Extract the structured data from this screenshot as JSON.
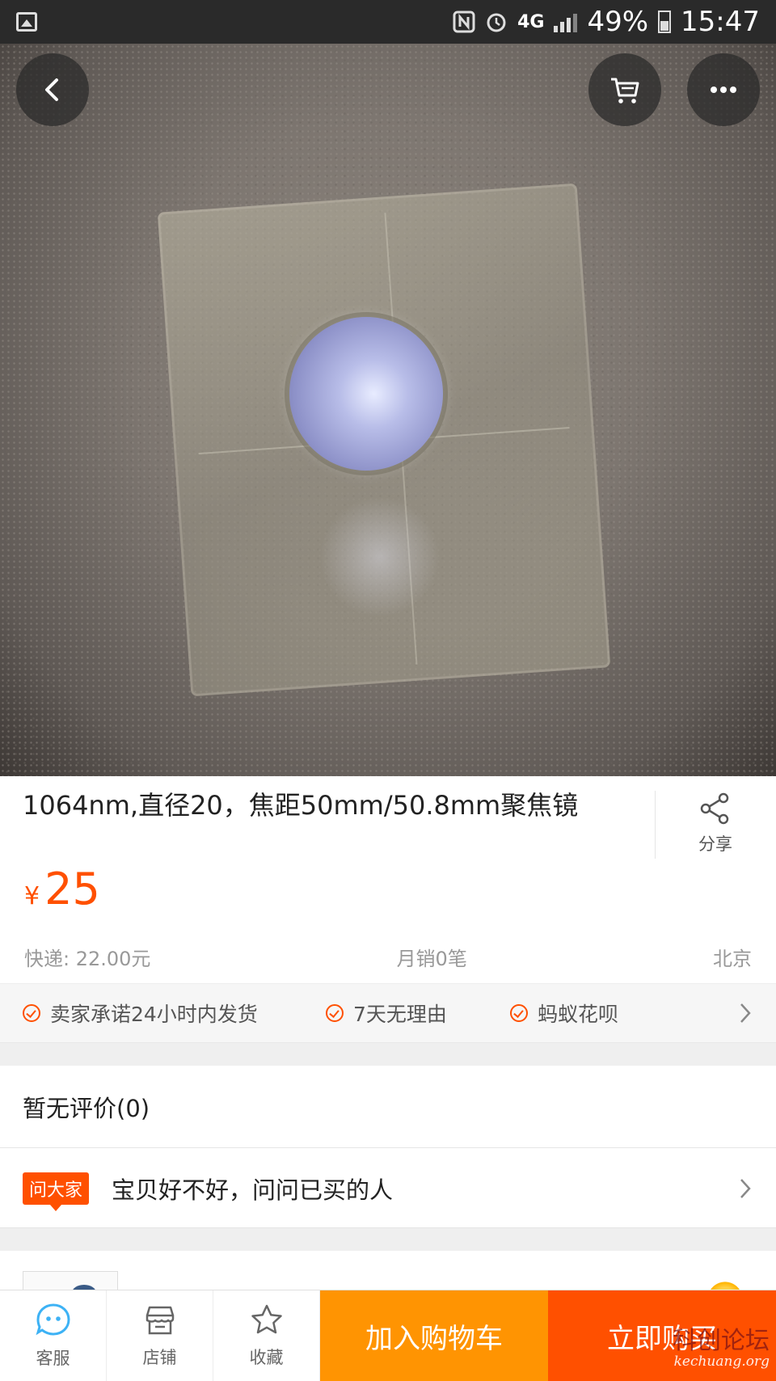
{
  "status_bar": {
    "network": "4G",
    "battery": "49%",
    "time": "15:47"
  },
  "product": {
    "title": "1064nm,直径20，焦距50mm/50.8mm聚焦镜",
    "share_label": "分享",
    "currency": "¥",
    "price": "25",
    "shipping": "快递: 22.00元",
    "monthly_sales": "月销0笔",
    "location": "北京"
  },
  "promises": [
    {
      "label": "卖家承诺24小时内发货"
    },
    {
      "label": "7天无理由"
    },
    {
      "label": "蚂蚁花呗"
    }
  ],
  "reviews": {
    "label": "暂无评价(0)"
  },
  "ask": {
    "badge": "问大家",
    "text": "宝贝好不好，问问已买的人"
  },
  "bottom_bar": {
    "service_label": "客服",
    "shop_label": "店铺",
    "favorite_label": "收藏",
    "add_to_cart_label": "加入购物车",
    "buy_now_label": "立即购买"
  },
  "watermark": {
    "text": "科创论坛",
    "url": "kechuang.org"
  },
  "colors": {
    "accent": "#ff5000",
    "cart_button": "#ff9402",
    "service_icon": "#3db2f5"
  }
}
